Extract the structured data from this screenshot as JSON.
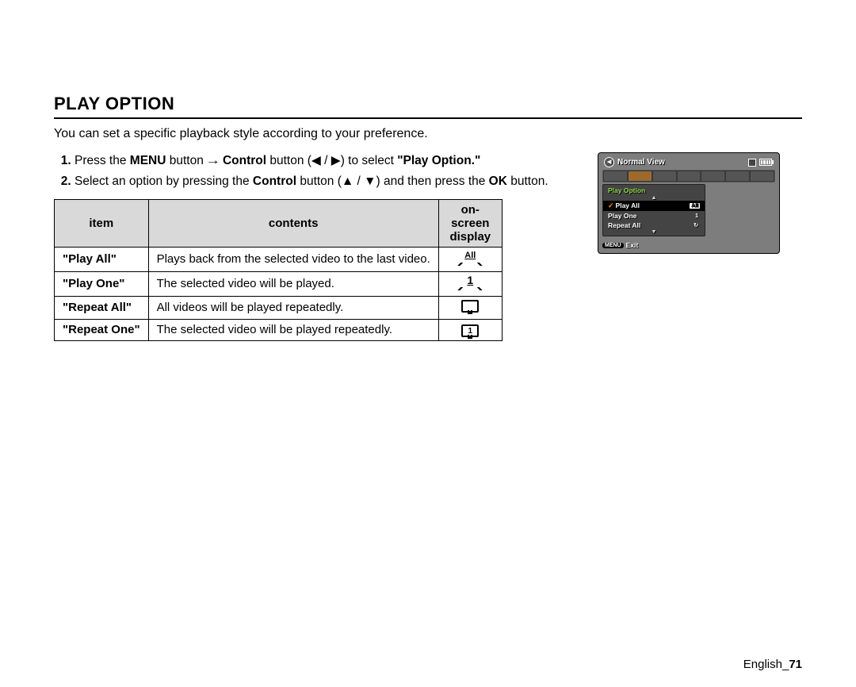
{
  "title": "PLAY OPTION",
  "intro": "You can set a specific playback style according to to your preference.",
  "introFixed": "You can set a specific playback style according to your preference.",
  "steps": {
    "s1": {
      "prefix": "Press the ",
      "menu": "MENU",
      "mid1": " button ",
      "arrow": "→",
      "control": " Control",
      "mid2": " button (",
      "left": "◀",
      "slash": " / ",
      "right": "▶",
      "mid3": ") to select ",
      "target": "\"Play Option.\""
    },
    "s2": {
      "prefix": "Select an option by pressing the ",
      "control": "Control",
      "mid1": " button (",
      "up": "▲",
      "slash": " / ",
      "down": "▼",
      "mid2": ") and then press the ",
      "ok": "OK",
      "suffix": " button."
    }
  },
  "table": {
    "h1": "item",
    "h2": "contents",
    "h3a": "on-screen",
    "h3b": "display",
    "rows": [
      {
        "item": "\"Play All\"",
        "contents": "Plays back from the selected video to the last video."
      },
      {
        "item": "\"Play One\"",
        "contents": "The selected video will be played."
      },
      {
        "item": "\"Repeat All\"",
        "contents": "All videos will be played repeatedly."
      },
      {
        "item": "\"Repeat One\"",
        "contents": "The selected video will be played repeatedly."
      }
    ]
  },
  "lcd": {
    "mode": "Normal View",
    "menuTitle": "Play Option",
    "items": [
      {
        "label": "Play All",
        "badge": "All",
        "active": true
      },
      {
        "label": "Play One",
        "badge": "1"
      },
      {
        "label": "Repeat All",
        "badge": "↻"
      }
    ],
    "menuBadge": "MENU",
    "exit": "Exit"
  },
  "footer": {
    "lang": "English",
    "sep": "_",
    "page": "71"
  }
}
